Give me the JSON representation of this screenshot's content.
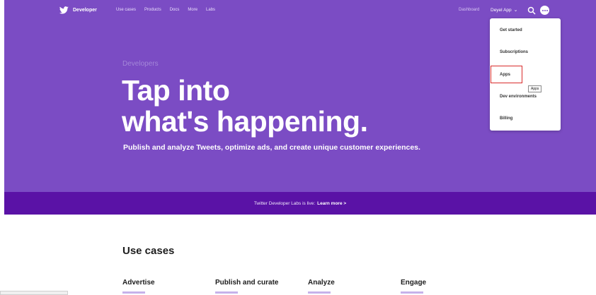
{
  "nav": {
    "brand": "Developer",
    "links": [
      "Use cases",
      "Products",
      "Docs",
      "More",
      "Labs"
    ],
    "dashboard": "Dashboard",
    "account_menu": "Deyel App",
    "icons": {
      "logo": "twitter-bird-icon",
      "search": "search-icon",
      "avatar": "avatar-icon",
      "chevron": "chevron-down-icon"
    }
  },
  "hero": {
    "eyebrow": "Developers",
    "headline_line1": "Tap into",
    "headline_line2": "what's happening.",
    "subline": "Publish and analyze Tweets, optimize ads, and create unique customer experiences."
  },
  "banner": {
    "text": "Twitter Developer Labs is live:",
    "link": "Learn more >"
  },
  "use_cases": {
    "title": "Use cases",
    "items": [
      "Advertise",
      "Publish and curate",
      "Analyze",
      "Engage"
    ]
  },
  "dropdown": {
    "items": [
      "Get started",
      "Subscriptions",
      "Apps",
      "Dev environments",
      "Billing"
    ],
    "highlighted": "Apps",
    "tooltip": "Apps"
  },
  "colors": {
    "hero_bg": "#7b4cc4",
    "banner_bg": "#5a12a6",
    "highlight_border": "#d92b2b"
  }
}
